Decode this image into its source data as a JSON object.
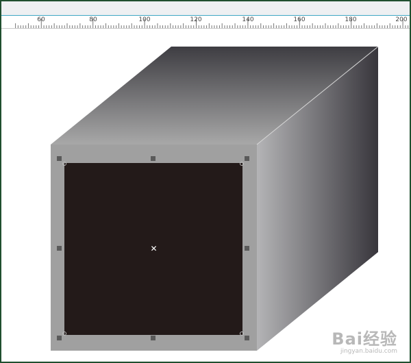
{
  "ruler": {
    "ticks": [
      {
        "label": "60"
      },
      {
        "label": "80"
      },
      {
        "label": "100"
      },
      {
        "label": "120"
      },
      {
        "label": "140"
      },
      {
        "label": "160"
      },
      {
        "label": "180"
      },
      {
        "label": "200"
      }
    ]
  },
  "watermark": {
    "brand": "Bai经验",
    "sub": "jingyan.baidu.com"
  },
  "colors": {
    "frame": "#1f4f2f",
    "accent_line": "#3fa7c4",
    "front_fill": "#a0a0a0",
    "inner_fill": "#231a19"
  },
  "icons": {
    "center": "center-x-icon",
    "handle": "selection-handle"
  }
}
